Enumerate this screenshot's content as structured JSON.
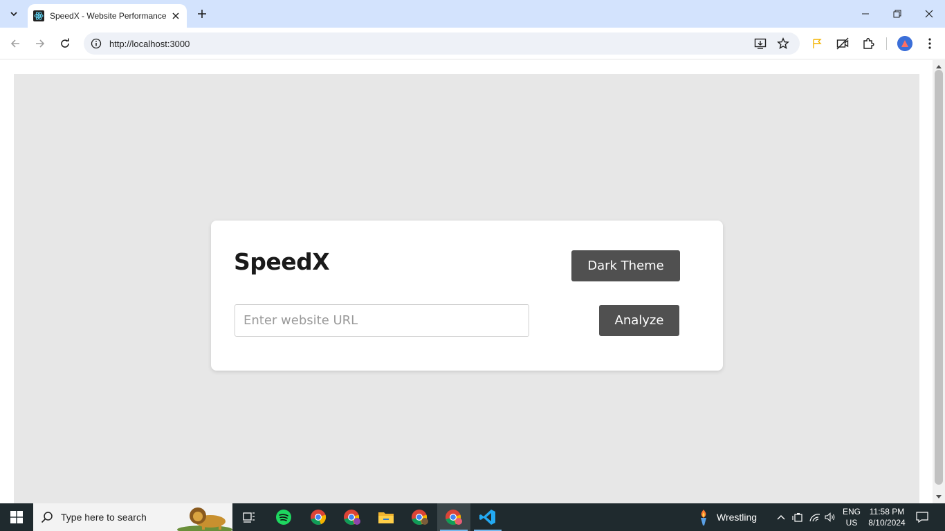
{
  "browser": {
    "tab": {
      "title": "SpeedX - Website Performance"
    },
    "address": {
      "url": "http://localhost:3000"
    }
  },
  "app": {
    "brand": "SpeedX",
    "theme_button": "Dark Theme",
    "url_input": {
      "placeholder": "Enter website URL",
      "value": ""
    },
    "analyze_button": "Analyze"
  },
  "taskbar": {
    "search_placeholder": "Type here to search",
    "weather": "Wrestling",
    "language": "ENG",
    "region": "US",
    "time": "11:58 PM",
    "date": "8/10/2024"
  },
  "colors": {
    "tabstrip": "#d3e3fd",
    "page_background": "#e7e7e7",
    "button": "#505050",
    "taskbar": "#1f2a2e"
  }
}
